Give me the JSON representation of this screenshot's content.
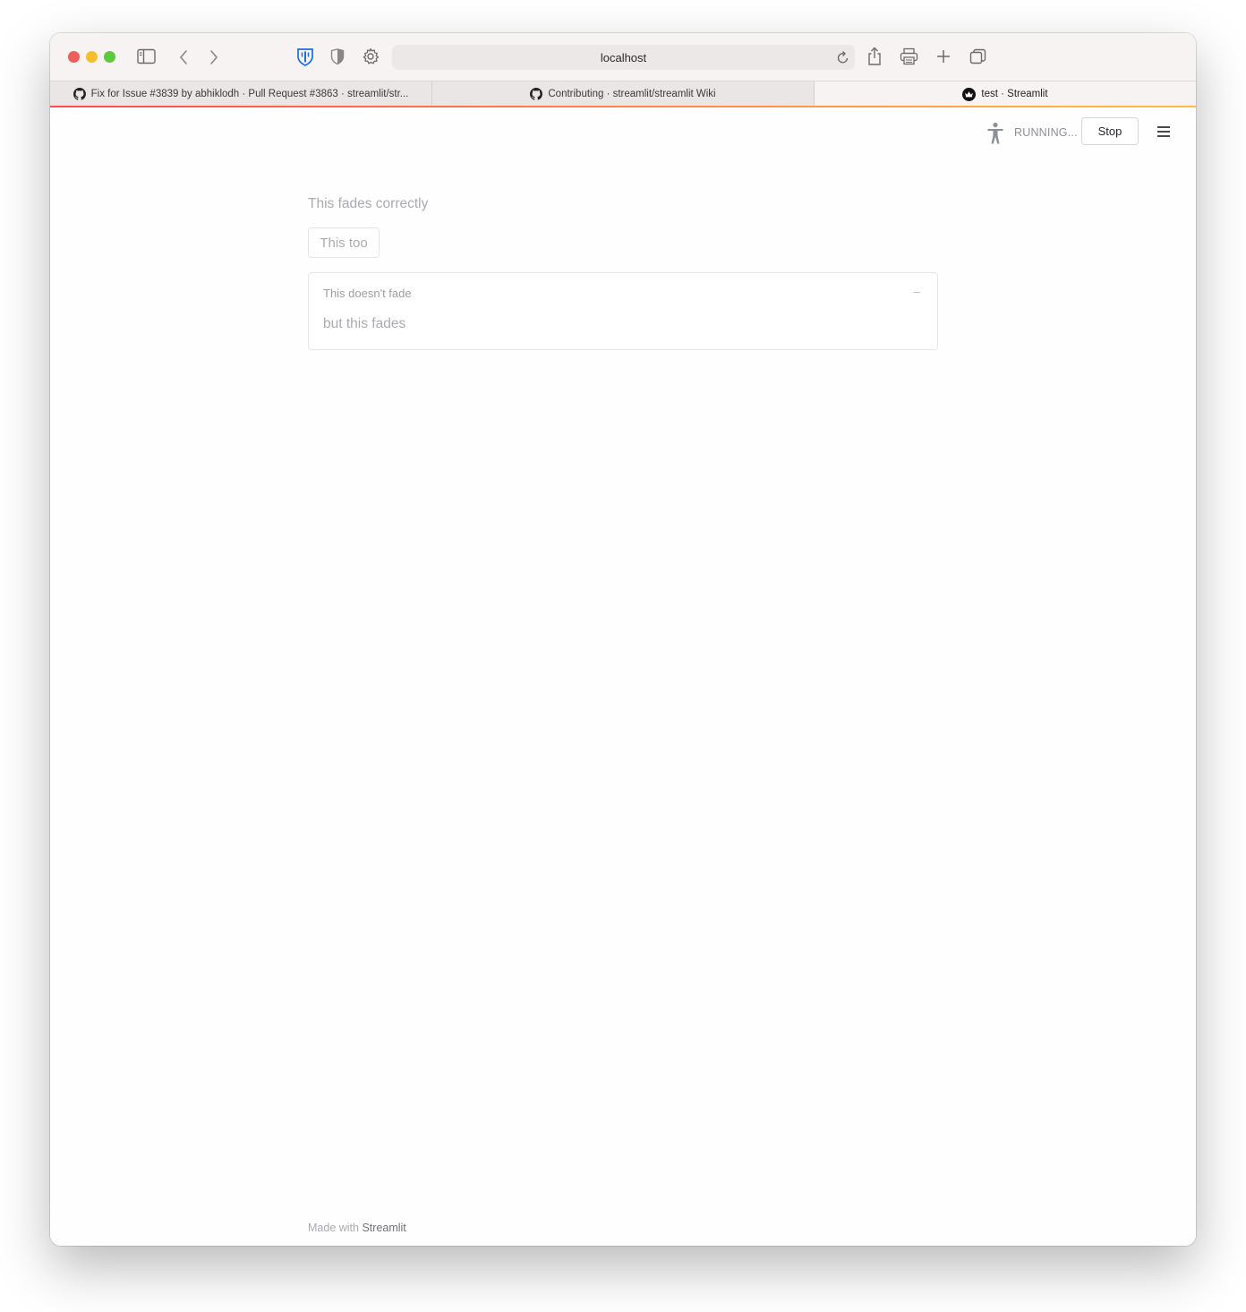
{
  "browser": {
    "address": "localhost",
    "tabs": [
      {
        "label": "Fix for Issue #3839 by abhiklodh · Pull Request #3863 · streamlit/str..."
      },
      {
        "label": "Contributing · streamlit/streamlit Wiki"
      },
      {
        "label": "test · Streamlit"
      }
    ]
  },
  "app": {
    "status": "RUNNING...",
    "stop_label": "Stop",
    "text_fades": "This fades correctly",
    "button_label": "This too",
    "expander_label": "This doesn't fade",
    "expander_toggle": "–",
    "expander_content": "but this fades",
    "footer_prefix": "Made with",
    "footer_brand": "Streamlit"
  },
  "colors": {
    "decoration_start": "#ff4b4b",
    "decoration_end": "#ffbd45",
    "faded_text": "#a9abb0"
  }
}
